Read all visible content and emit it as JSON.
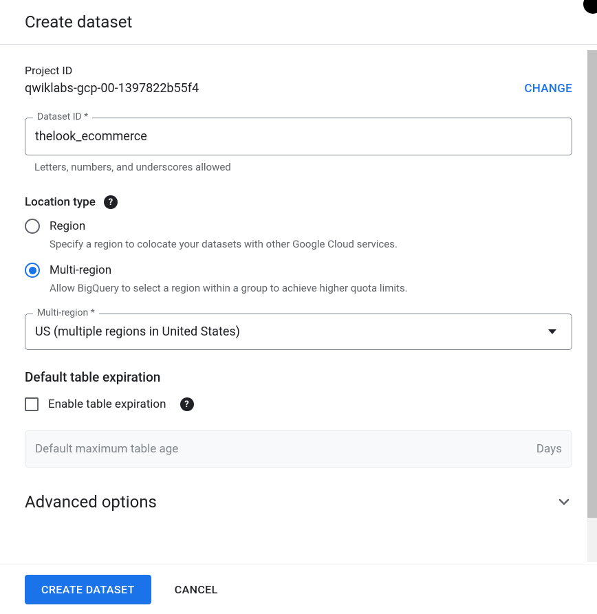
{
  "header": {
    "title": "Create dataset"
  },
  "project": {
    "label": "Project ID",
    "value": "qwiklabs-gcp-00-1397822b55f4",
    "change_label": "CHANGE"
  },
  "dataset_id": {
    "label": "Dataset ID *",
    "value": "thelook_ecommerce",
    "helper": "Letters, numbers, and underscores allowed"
  },
  "location": {
    "title": "Location type",
    "options": [
      {
        "label": "Region",
        "description": "Specify a region to colocate your datasets with other Google Cloud services.",
        "selected": false
      },
      {
        "label": "Multi-region",
        "description": "Allow BigQuery to select a region within a group to achieve higher quota limits.",
        "selected": true
      }
    ]
  },
  "multiregion": {
    "label": "Multi-region *",
    "value": "US (multiple regions in United States)"
  },
  "expiration": {
    "title": "Default table expiration",
    "checkbox_label": "Enable table expiration",
    "checked": false,
    "field_placeholder": "Default maximum table age",
    "field_unit": "Days"
  },
  "advanced": {
    "title": "Advanced options"
  },
  "footer": {
    "create_label": "CREATE DATASET",
    "cancel_label": "CANCEL"
  }
}
